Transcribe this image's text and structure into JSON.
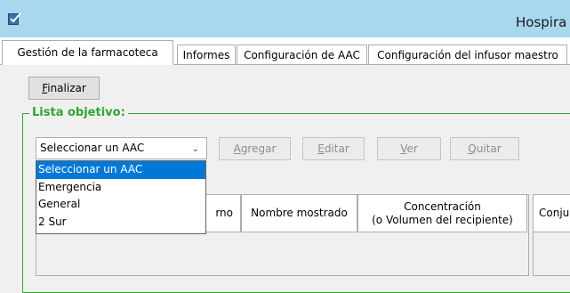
{
  "window": {
    "title": "Hospira"
  },
  "tabs": [
    {
      "label": "Gestión de la farmacoteca",
      "active": true
    },
    {
      "label": "Informes",
      "active": false
    },
    {
      "label": "Configuración de AAC",
      "active": false
    },
    {
      "label": "Configuración del infusor maestro",
      "active": false
    }
  ],
  "toolbar": {
    "finalize_label": "Finalizar"
  },
  "target_list": {
    "title": "Lista objetivo:",
    "select_value": "Seleccionar un AAC",
    "actions": {
      "add": "Agregar",
      "edit": "Editar",
      "view": "Ver",
      "remove": "Quitar"
    }
  },
  "dropdown": {
    "options": [
      "Seleccionar un AAC",
      "Emergencia",
      "General",
      "2 Sur"
    ],
    "selected_index": 0
  },
  "table": {
    "headers": {
      "col_partial": "rno",
      "display_name": "Nombre mostrado",
      "concentration_line1": "Concentración",
      "concentration_line2": "(o Volumen del recipiente)",
      "right_partial": "Conjur"
    }
  },
  "colors": {
    "titlebar": "#a8d7ee",
    "group_accent": "#30a530",
    "selection": "#0078d7"
  }
}
